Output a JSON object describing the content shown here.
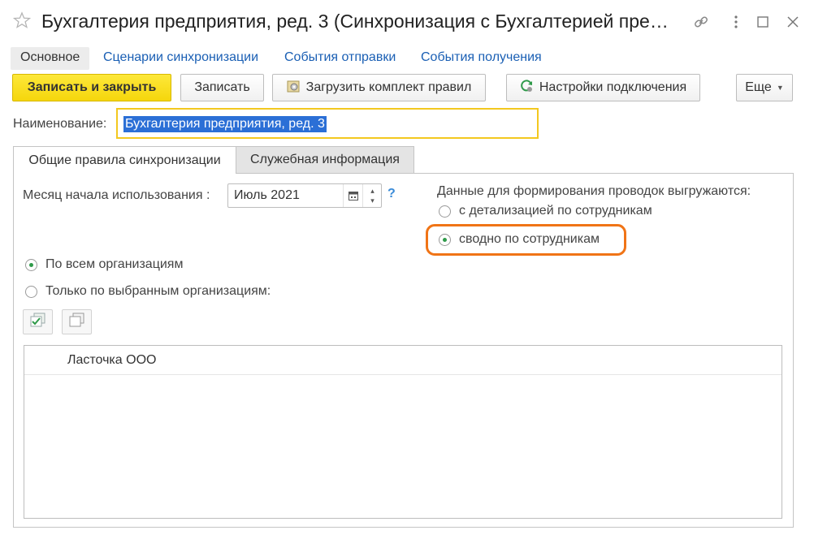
{
  "window": {
    "title": "Бухгалтерия предприятия, ред. 3 (Синхронизация с Бухгалтерией пре…"
  },
  "nav_tabs": [
    {
      "label": "Основное",
      "active": true
    },
    {
      "label": "Сценарии синхронизации",
      "active": false
    },
    {
      "label": "События отправки",
      "active": false
    },
    {
      "label": "События получения",
      "active": false
    }
  ],
  "toolbar": {
    "save_close": "Записать и закрыть",
    "save": "Записать",
    "load_rules": "Загрузить комплект правил",
    "connection_settings": "Настройки подключения",
    "more": "Еще"
  },
  "name_field": {
    "label": "Наименование:",
    "value": "Бухгалтерия предприятия, ред. 3"
  },
  "inner_tabs": [
    {
      "label": "Общие правила синхронизации",
      "active": true
    },
    {
      "label": "Служебная информация",
      "active": false
    }
  ],
  "general": {
    "month_label": "Месяц начала использования :",
    "month_value": "Июль 2021",
    "help": "?",
    "posting_label": "Данные для формирования проводок выгружаются:",
    "posting_options": [
      {
        "label": "с детализацией по сотрудникам",
        "checked": false
      },
      {
        "label": "сводно по сотрудникам",
        "checked": true
      }
    ],
    "org_options": [
      {
        "label": "По всем организациям",
        "checked": true
      },
      {
        "label": "Только по выбранным организациям:",
        "checked": false
      }
    ],
    "organizations": [
      "Ласточка ООО"
    ]
  },
  "colors": {
    "primary_button": "#f5d60c",
    "link": "#1a5fb4",
    "radio_dot": "#2f9a4a",
    "highlight": "#f07416",
    "field_focus": "#f3c81f"
  }
}
